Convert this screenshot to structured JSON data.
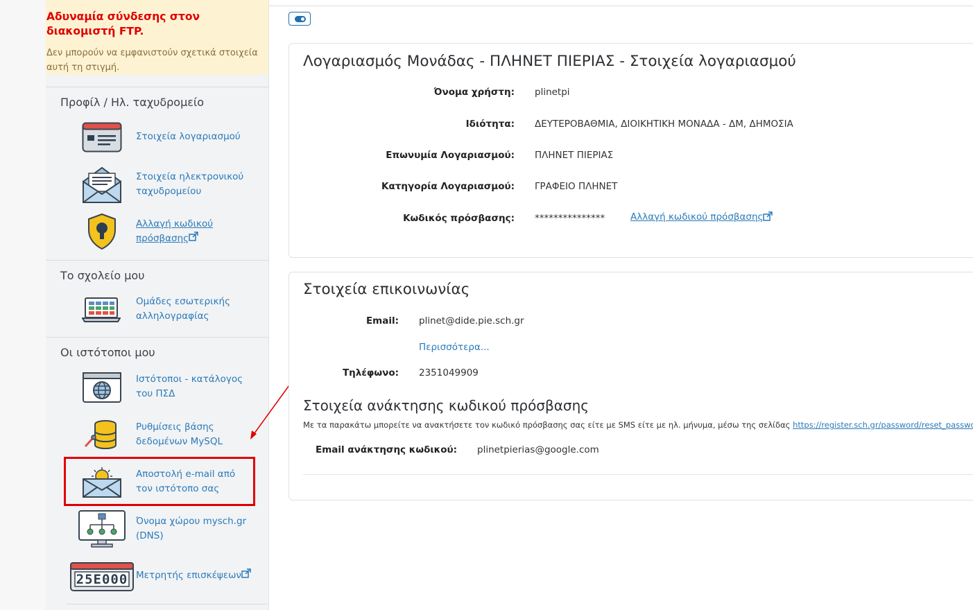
{
  "alert": {
    "title": "Αδυναμία σύνδεσης στον διακομιστή FTP.",
    "text": "Δεν μπορούν να εμφανιστούν σχετικά στοιχεία αυτή τη στιγμή."
  },
  "sidebar": {
    "profile": {
      "title": "Προφίλ / Ηλ. ταχυδρομείο",
      "items": [
        {
          "label": "Στοιχεία λογαριασμού",
          "icon": "account-card-icon"
        },
        {
          "label": "Στοιχεία ηλεκτρονικού ταχυδρομείου",
          "icon": "mail-envelope-icon"
        },
        {
          "label": "Αλλαγή κωδικού πρόσβασης",
          "icon": "shield-lock-icon"
        }
      ]
    },
    "school": {
      "title": "Το σχολείο μου",
      "items": [
        {
          "label": "Ομάδες εσωτερικής αλληλογραφίας",
          "icon": "laptop-groups-icon"
        }
      ]
    },
    "sites": {
      "title": "Οι ιστότοποι μου",
      "items": [
        {
          "label": "Ιστότοποι - κατάλογος του ΠΣΔ",
          "icon": "globe-window-icon"
        },
        {
          "label": "Ρυθμίσεις βάσης δεδομένων MySQL",
          "icon": "database-icon"
        },
        {
          "label": "Αποστολή e-mail από τον ιστότοπο σας",
          "icon": "sun-envelope-icon"
        },
        {
          "label": "Όνομα χώρου mysch.gr (DNS)",
          "icon": "network-monitor-icon"
        },
        {
          "label": "Μετρητής επισκέψεων",
          "icon": "counter-icon",
          "counter": "25E000"
        }
      ]
    }
  },
  "account": {
    "title": "Λογαριασμός Μονάδας - ΠΛΗΝΕΤ ΠΙΕΡΙΑΣ - Στοιχεία λογαριασμού",
    "rows": [
      {
        "label": "Όνομα χρήστη:",
        "value": "plinetpi"
      },
      {
        "label": "Ιδιότητα:",
        "value": "ΔΕΥΤΕΡΟΒΑΘΜΙΑ, ΔΙΟΙΚΗΤΙΚΗ ΜΟΝΑΔΑ - ΔΜ, ΔΗΜΟΣΙΑ"
      },
      {
        "label": "Επωνυμία Λογαριασμού:",
        "value": "ΠΛΗΝΕΤ ΠΙΕΡΙΑΣ"
      },
      {
        "label": "Κατηγορία Λογαριασμού:",
        "value": "ΓΡΑΦΕΙΟ ΠΛΗΝΕΤ"
      },
      {
        "label": "Κωδικός πρόσβασης:",
        "value": "***************"
      }
    ],
    "change_password_link": "Αλλαγή κωδικού πρόσβασης"
  },
  "contact": {
    "title": "Στοιχεία επικοινωνίας",
    "email_label": "Email:",
    "email_value": "plinet@dide.pie.sch.gr",
    "more_link": "Περισσότερα...",
    "phone_label": "Τηλέφωνο:",
    "phone_value": "2351049909"
  },
  "recovery": {
    "title": "Στοιχεία ανάκτησης κωδικού πρόσβασης",
    "desc": "Με τα παρακάτω μπορείτε να ανακτήσετε τον κωδικό πρόσβασης σας είτε με SMS είτε με ηλ. μήνυμα, μέσω της σελίδας ",
    "desc_link": "https://register.sch.gr/password/reset_password/",
    "email_label": "Email ανάκτησης κωδικού:",
    "email_value": "plinetpierias@google.com"
  },
  "colors": {
    "link": "#2a7ab8",
    "alert_bg": "#fdf3d3",
    "alert_title": "#e00000",
    "annotation": "#e00000"
  }
}
